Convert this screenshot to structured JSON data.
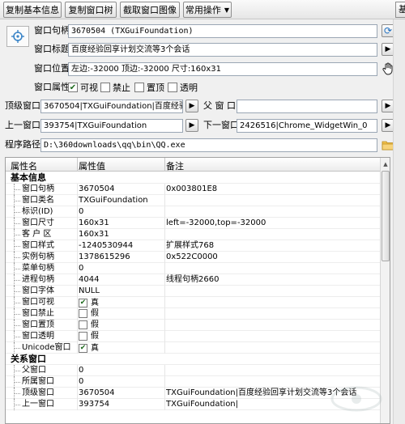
{
  "toolbar": {
    "copy_basic_info": "复制基本信息",
    "copy_window_tree": "复制窗口树",
    "capture_window_image": "截取窗口图像",
    "common_ops": "常用操作",
    "edge_button": "基"
  },
  "form": {
    "handle_label": "窗口句柄",
    "handle_value": "3670504  (TXGuiFoundation)",
    "title_label": "窗口标题",
    "title_value": "百度经验回享计划交流等3个会话",
    "position_label": "窗口位置",
    "position_value": "左边:-32000 顶边:-32000 尺寸:160x31",
    "attr_label": "窗口属性",
    "attr_visible": "可视",
    "attr_disabled": "禁止",
    "attr_topmost": "置顶",
    "attr_transparent": "透明",
    "top_window_label": "顶级窗口",
    "top_window_value": "3670504|TXGuiFoundation|百度经验回",
    "parent_label": "父 窗 口",
    "parent_value": "",
    "prev_label": "上一窗口",
    "prev_value": "393754|TXGuiFoundation",
    "next_label": "下一窗口",
    "next_value": "2426516|Chrome_WidgetWin_0",
    "path_label": "程序路径",
    "path_value": "D:\\360downloads\\qq\\bin\\QQ.exe"
  },
  "grid": {
    "headers": [
      "属性名",
      "属性值",
      "备注"
    ],
    "rows": [
      {
        "type": "section",
        "name": "基本信息"
      },
      {
        "name": "窗口句柄",
        "value": "3670504",
        "note": "0x003801E8"
      },
      {
        "name": "窗口类名",
        "value": "TXGuiFoundation",
        "note": ""
      },
      {
        "name": "标识(ID)",
        "value": "0",
        "note": ""
      },
      {
        "name": "窗口尺寸",
        "value": "160x31",
        "note": "left=-32000,top=-32000"
      },
      {
        "name": "客 户 区",
        "value": "160x31",
        "note": ""
      },
      {
        "name": "窗口样式",
        "value": "-1240530944",
        "note": "扩展样式768"
      },
      {
        "name": "实例句柄",
        "value": "1378615296",
        "note": "0x522C0000"
      },
      {
        "name": "菜单句柄",
        "value": "0",
        "note": ""
      },
      {
        "name": "进程句柄",
        "value": "4044",
        "note": "线程句柄2660"
      },
      {
        "name": "窗口字体",
        "value": "NULL",
        "note": ""
      },
      {
        "name": "窗口可视",
        "check": true,
        "value": "真",
        "note": ""
      },
      {
        "name": "窗口禁止",
        "check": false,
        "value": "假",
        "note": ""
      },
      {
        "name": "窗口置顶",
        "check": false,
        "value": "假",
        "note": ""
      },
      {
        "name": "窗口透明",
        "check": false,
        "value": "假",
        "note": ""
      },
      {
        "name": "Unicode窗口",
        "check": true,
        "value": "真",
        "note": ""
      },
      {
        "type": "section",
        "name": "关系窗口"
      },
      {
        "name": "父窗口",
        "value": "0",
        "note": ""
      },
      {
        "name": "所属窗口",
        "value": "0",
        "note": ""
      },
      {
        "name": "顶级窗口",
        "value": "3670504",
        "note": "TXGuiFoundation|百度经验回享计划交流等3个会话"
      },
      {
        "name": "上一窗口",
        "value": "393754",
        "note": "TXGuiFoundation|"
      }
    ]
  },
  "colors": {
    "check_mark": "#1f6b1f",
    "field_border": "#9aa6b4"
  }
}
